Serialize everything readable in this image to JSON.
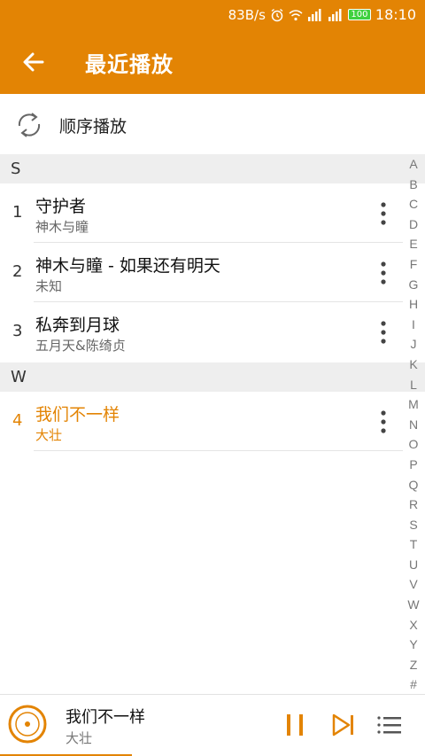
{
  "status_bar": {
    "speed": "83B/s",
    "battery": "100",
    "time": "18:10",
    "icons": [
      "alarm-icon",
      "wifi-icon",
      "signal-4g-icon",
      "signal-2g-icon",
      "battery-icon"
    ]
  },
  "app_bar": {
    "title": "最近播放",
    "back_icon": "arrow-left-icon"
  },
  "mode": {
    "label": "顺序播放",
    "icon": "repeat-icon"
  },
  "sections": [
    {
      "letter": "S",
      "songs": [
        {
          "num": "1",
          "title": "守护者",
          "artist": "神木与瞳"
        },
        {
          "num": "2",
          "title": "神木与瞳 - 如果还有明天",
          "artist": "未知"
        },
        {
          "num": "3",
          "title": "私奔到月球",
          "artist": "五月天&陈绮贞"
        }
      ]
    },
    {
      "letter": "W",
      "songs": [
        {
          "num": "4",
          "title": "我们不一样",
          "artist": "大壮"
        }
      ]
    }
  ],
  "alpha_index": [
    "A",
    "B",
    "C",
    "D",
    "E",
    "F",
    "G",
    "H",
    "I",
    "J",
    "K",
    "L",
    "M",
    "N",
    "O",
    "P",
    "Q",
    "R",
    "S",
    "T",
    "U",
    "V",
    "W",
    "X",
    "Y",
    "Z",
    "#"
  ],
  "player": {
    "title": "我们不一样",
    "artist": "大壮",
    "progress": 0.31
  },
  "colors": {
    "accent": "#e38404",
    "section_bg": "#eeeeee",
    "active_text": "#e38404"
  }
}
